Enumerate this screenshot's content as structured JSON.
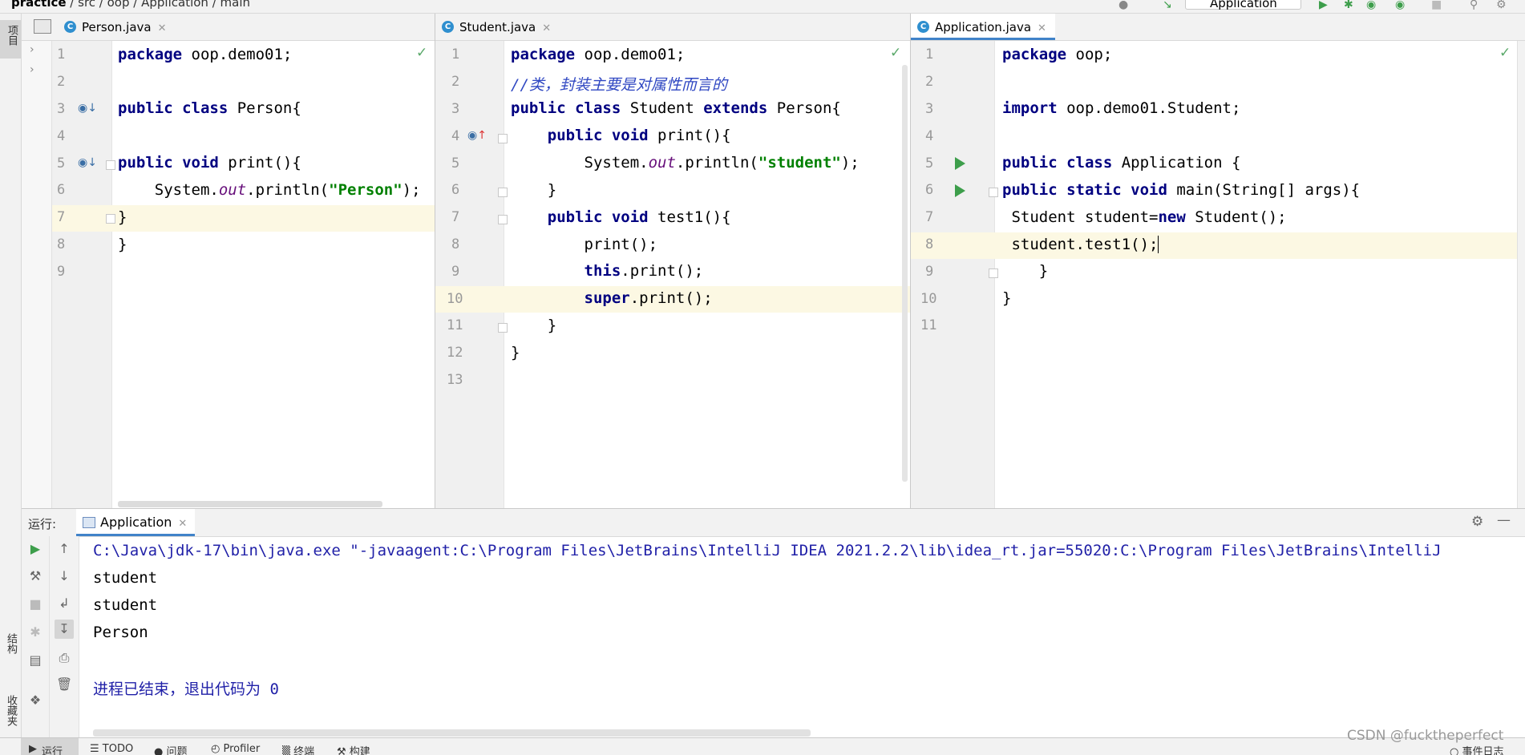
{
  "breadcrumbs": [
    "practice",
    "src",
    "oop",
    "Application",
    "main"
  ],
  "toolbar": {
    "run_config": "Application"
  },
  "left_strip": {
    "project_label": "项目",
    "structure_label": "结构",
    "favorites_label": "收藏夹"
  },
  "editors": [
    {
      "tab": "Person.java",
      "lines": [
        "1",
        "2",
        "3",
        "4",
        "5",
        "6",
        "7",
        "8",
        "9"
      ]
    },
    {
      "tab": "Student.java",
      "lines": [
        "1",
        "2",
        "3",
        "4",
        "5",
        "6",
        "7",
        "8",
        "9",
        "10",
        "11",
        "12",
        "13"
      ]
    },
    {
      "tab": "Application.java",
      "lines": [
        "1",
        "2",
        "3",
        "4",
        "5",
        "6",
        "7",
        "8",
        "9",
        "10",
        "11"
      ]
    }
  ],
  "code": {
    "person": {
      "l1": [
        "package",
        " oop.demo01;"
      ],
      "l3": [
        "public class",
        " Person{"
      ],
      "l5": [
        "public void",
        " print(){"
      ],
      "l6": [
        "    System.",
        "out",
        ".println(",
        "\"Person\"",
        ");"
      ],
      "l7": "}",
      "l8": "}"
    },
    "student": {
      "l1": [
        "package",
        " oop.demo01;"
      ],
      "l2": "//类，封装主要是对属性而言的",
      "l3": [
        "public class",
        " Student ",
        "extends",
        " Person{"
      ],
      "l4": [
        "    ",
        "public void",
        " print(){"
      ],
      "l5": [
        "        System.",
        "out",
        ".println(",
        "\"student\"",
        ");"
      ],
      "l6": "    }",
      "l7": [
        "    ",
        "public void",
        " test1(){"
      ],
      "l8": "        print();",
      "l9": [
        "        ",
        "this",
        ".print();"
      ],
      "l10": [
        "        ",
        "super",
        ".print();"
      ],
      "l11": "    }",
      "l12": "}"
    },
    "application": {
      "l1": [
        "package",
        " oop;"
      ],
      "l3": [
        "import",
        " oop.demo01.Student;"
      ],
      "l5": [
        "public class",
        " Application {"
      ],
      "l6": [
        "public static void",
        " main(String[] args){"
      ],
      "l7": [
        " Student student=",
        "new",
        " Student();"
      ],
      "l8": " student.test1();",
      "l9": "    }",
      "l10": "}"
    }
  },
  "run_panel": {
    "label": "运行:",
    "tab": "Application",
    "output": [
      "C:\\Java\\jdk-17\\bin\\java.exe \"-javaagent:C:\\Program Files\\JetBrains\\IntelliJ IDEA 2021.2.2\\lib\\idea_rt.jar=55020:C:\\Program Files\\JetBrains\\IntelliJ",
      "student",
      "student",
      "Person",
      "",
      "进程已结束，退出代码为 0"
    ]
  },
  "bottom_tabs": [
    "运行",
    "TODO",
    "问题",
    "Profiler",
    "终端",
    "构建",
    "事件日志"
  ],
  "watermark": "CSDN @fucktheperfect",
  "colors": {
    "keyword": "#000080",
    "string": "#008000",
    "comment": "#2f47c2",
    "field": "#660e7a",
    "accent": "#4083c9",
    "run_green": "#3d9e4b",
    "line_highlight": "#fcf8e3"
  }
}
